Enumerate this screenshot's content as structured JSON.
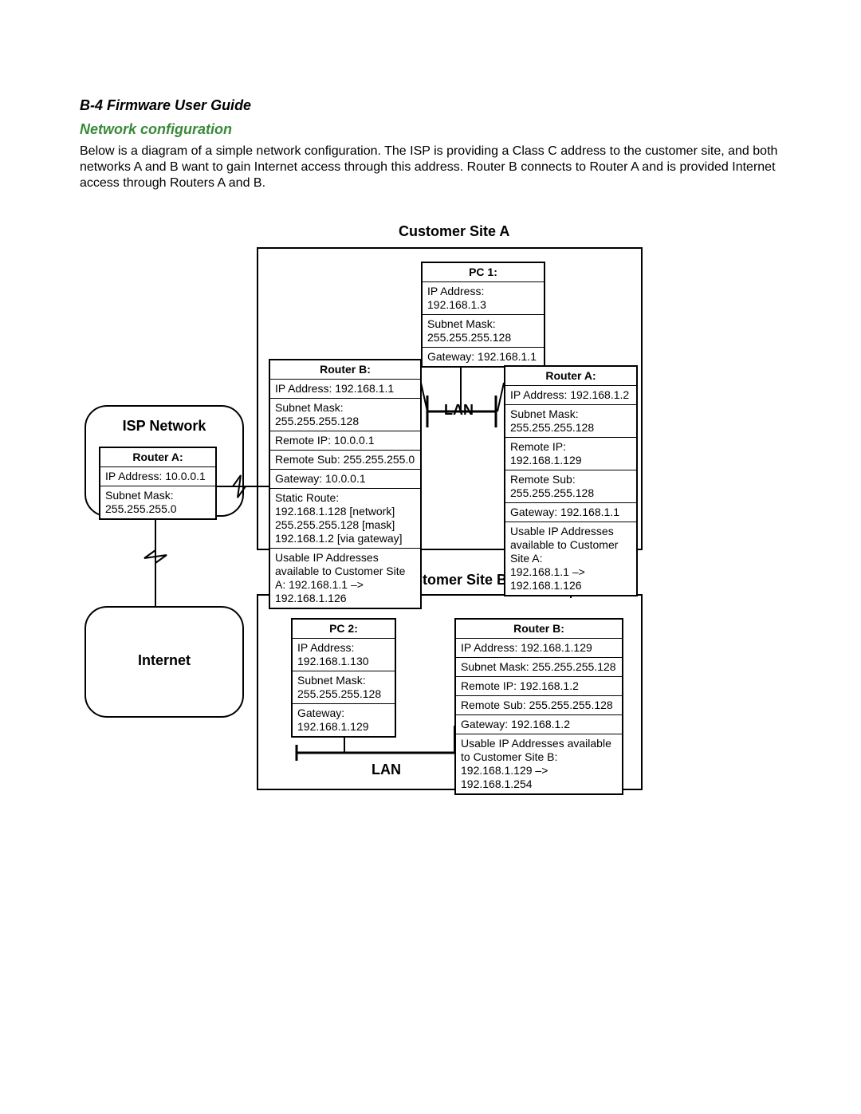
{
  "header": "B-4  Firmware User Guide",
  "section": "Network configuration",
  "intro": "Below is a diagram of a simple network configuration. The ISP is providing a Class C address to the customer site, and both networks A and B want to gain Internet access through this address. Router B connects to Router A and is provided Internet access through Routers A and B.",
  "siteA_title": "Customer Site A",
  "siteB_title": "Customer Site B",
  "lan_a": "LAN",
  "lan_b": "LAN",
  "isp": {
    "label": "ISP Network",
    "router_title": "Router A:",
    "ip": "IP Address: 10.0.0.1",
    "mask": "Subnet Mask:\n255.255.255.0"
  },
  "internet_label": "Internet",
  "pc1": {
    "title": "PC 1:",
    "ip": "IP Address:\n192.168.1.3",
    "mask": "Subnet Mask:\n255.255.255.128",
    "gw": "Gateway: 192.168.1.1"
  },
  "routerB_A": {
    "title": "Router B:",
    "ip": "IP Address: 192.168.1.1",
    "mask": "Subnet Mask: 255.255.255.128",
    "rip": "Remote IP: 10.0.0.1",
    "rsub": "Remote Sub: 255.255.255.0",
    "gw": "Gateway: 10.0.0.1",
    "route": "Static Route:\n192.168.1.128 [network]\n255.255.255.128 [mask]\n192.168.1.2 [via gateway]",
    "usable": "Usable IP Addresses available to Customer Site A: 192.168.1.1 –>\n192.168.1.126"
  },
  "routerA_A": {
    "title": "Router A:",
    "ip": "IP Address: 192.168.1.2",
    "mask": "Subnet Mask:\n255.255.255.128",
    "rip": "Remote IP: 192.168.1.129",
    "rsub": "Remote Sub:\n255.255.255.128",
    "gw": "Gateway: 192.168.1.1",
    "usable": "Usable IP Addresses available to Customer Site A:\n192.168.1.1 –>\n192.168.1.126"
  },
  "pc2": {
    "title": "PC 2:",
    "ip": "IP Address:\n192.168.1.130",
    "mask": "Subnet Mask:\n255.255.255.128",
    "gw": "Gateway:\n192.168.1.129"
  },
  "routerB_B": {
    "title": "Router B:",
    "ip": "IP Address: 192.168.1.129",
    "mask": "Subnet Mask: 255.255.255.128",
    "rip": "Remote IP: 192.168.1.2",
    "rsub": "Remote Sub: 255.255.255.128",
    "gw": "Gateway: 192.168.1.2",
    "usable": "Usable IP Addresses available to Customer Site B: 192.168.1.129 –> 192.168.1.254"
  }
}
